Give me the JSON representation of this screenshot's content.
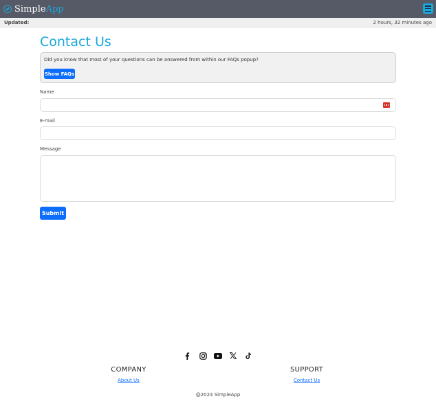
{
  "header": {
    "brand_part1": "Simple",
    "brand_part2": "App",
    "logo_icon": "simpleapp-logo-icon",
    "menu_icon": "hamburger-menu-icon",
    "accent_color": "#1aa7dc",
    "bar_color": "#565a66"
  },
  "updated": {
    "label": "Updated:",
    "value": "2 hours, 32 minutes ago"
  },
  "page": {
    "title": "Contact Us"
  },
  "faq": {
    "text": "Did you know that most of your questions can be answered from within our FAQs popup?",
    "button_label": "Show FAQs"
  },
  "form": {
    "name_label": "Name",
    "name_value": "",
    "email_label": "E-mail",
    "email_value": "",
    "message_label": "Message",
    "message_value": "",
    "password_manager_icon": "password-manager-icon",
    "submit_label": "Submit",
    "button_color": "#0d6efd"
  },
  "footer": {
    "social_icons": [
      "facebook-icon",
      "instagram-icon",
      "youtube-icon",
      "x-icon",
      "tiktok-icon"
    ],
    "company_heading": "COMPANY",
    "company_link": "About Us",
    "support_heading": "SUPPORT",
    "support_link": "Contact Us",
    "copyright": "@2024 SimpleApp"
  }
}
